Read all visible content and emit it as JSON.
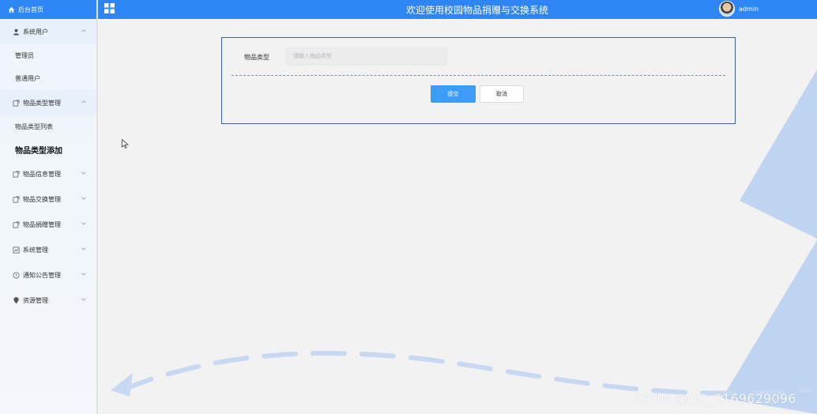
{
  "sidebar": {
    "home_label": "后台首页",
    "groups": [
      {
        "label": "系统用户",
        "icon": "user-icon",
        "open": true,
        "items": [
          "管理员",
          "普通用户"
        ]
      },
      {
        "label": "物品类型管理",
        "icon": "share-icon",
        "open": true,
        "items": [
          "物品类型列表",
          "物品类型添加"
        ]
      },
      {
        "label": "物品信息管理",
        "icon": "share-icon",
        "open": false
      },
      {
        "label": "物品交换管理",
        "icon": "share-icon",
        "open": false
      },
      {
        "label": "物品捐赠管理",
        "icon": "share-icon",
        "open": false
      },
      {
        "label": "系统管理",
        "icon": "chart-icon",
        "open": false
      },
      {
        "label": "通知公告管理",
        "icon": "info-icon",
        "open": false
      },
      {
        "label": "资源管理",
        "icon": "pin-icon",
        "open": false
      }
    ],
    "active_item": "物品类型添加"
  },
  "header": {
    "title": "欢迎使用校园物品捐赠与交换系统",
    "username": "admin"
  },
  "form": {
    "type_label": "物品类型",
    "type_value": "",
    "type_placeholder": "请输入物品类型",
    "submit_label": "提交",
    "cancel_label": "取消"
  },
  "watermark": "CSDN @QQ_2169629096",
  "colors": {
    "primary": "#2e86f5",
    "button": "#3d9cf8",
    "card_border": "#3a62a8"
  }
}
